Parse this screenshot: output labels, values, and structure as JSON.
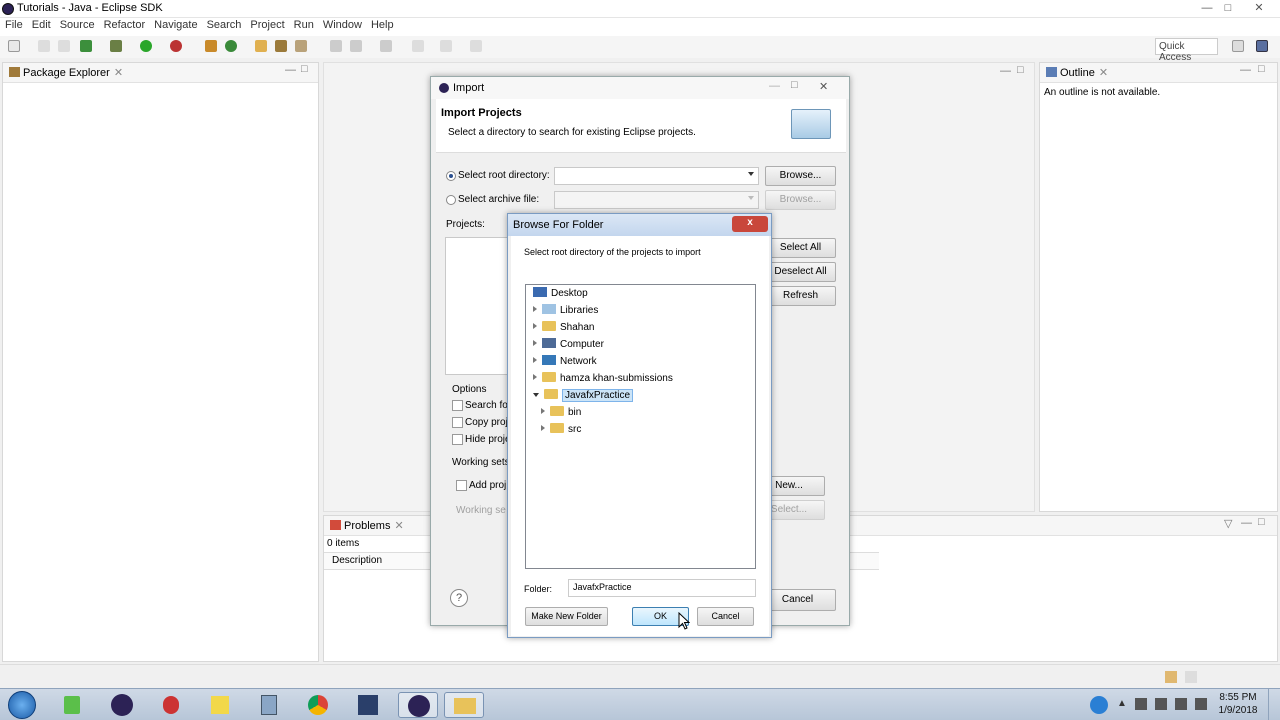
{
  "window": {
    "title": "Tutorials - Java - Eclipse SDK",
    "minimize": "—",
    "maximize": "□",
    "close": "✕"
  },
  "menu": [
    "File",
    "Edit",
    "Source",
    "Refactor",
    "Navigate",
    "Search",
    "Project",
    "Run",
    "Window",
    "Help"
  ],
  "toolbar": {
    "quick_access": "Quick Access"
  },
  "package_explorer": {
    "title": "Package Explorer"
  },
  "outline": {
    "title": "Outline",
    "message": "An outline is not available."
  },
  "problems": {
    "title": "Problems",
    "count": "0 items",
    "col_description": "Description"
  },
  "import_dialog": {
    "window_title": "Import",
    "heading": "Import Projects",
    "subtitle": "Select a directory to search for existing Eclipse projects.",
    "root_dir_label": "Select root directory:",
    "archive_label": "Select archive file:",
    "browse": "Browse...",
    "projects_label": "Projects:",
    "select_all": "Select All",
    "deselect_all": "Deselect All",
    "refresh": "Refresh",
    "options_label": "Options",
    "opt_search": "Search fo",
    "opt_copy": "Copy proj",
    "opt_hide": "Hide proje",
    "working_sets_label": "Working sets",
    "add_project": "Add proj",
    "working_sets_field": "Working se",
    "new": "New...",
    "select": "Select...",
    "cancel": "Cancel",
    "help": "?"
  },
  "browse_dialog": {
    "title": "Browse For Folder",
    "instruction": "Select root directory of the projects to import",
    "tree": [
      {
        "label": "Desktop",
        "icon": "desktop-icon"
      },
      {
        "label": "Libraries",
        "icon": "libraries-icon"
      },
      {
        "label": "Shahan",
        "icon": "user-folder-icon"
      },
      {
        "label": "Computer",
        "icon": "computer-icon"
      },
      {
        "label": "Network",
        "icon": "network-icon"
      },
      {
        "label": "hamza khan-submissions",
        "icon": "folder-icon"
      },
      {
        "label": "JavafxPractice",
        "icon": "folder-icon",
        "selected": true
      },
      {
        "label": "bin",
        "icon": "folder-icon"
      },
      {
        "label": "src",
        "icon": "folder-icon"
      }
    ],
    "folder_label": "Folder:",
    "folder_value": "JavafxPractice",
    "make_new_folder": "Make New Folder",
    "ok": "OK",
    "cancel": "Cancel",
    "close": "x"
  },
  "taskbar": {
    "time": "8:55 PM",
    "date": "1/9/2018"
  },
  "colors": {
    "selection": "#cce4f7",
    "dialog_close": "#c9473b",
    "accent": "#2a4f8f"
  }
}
